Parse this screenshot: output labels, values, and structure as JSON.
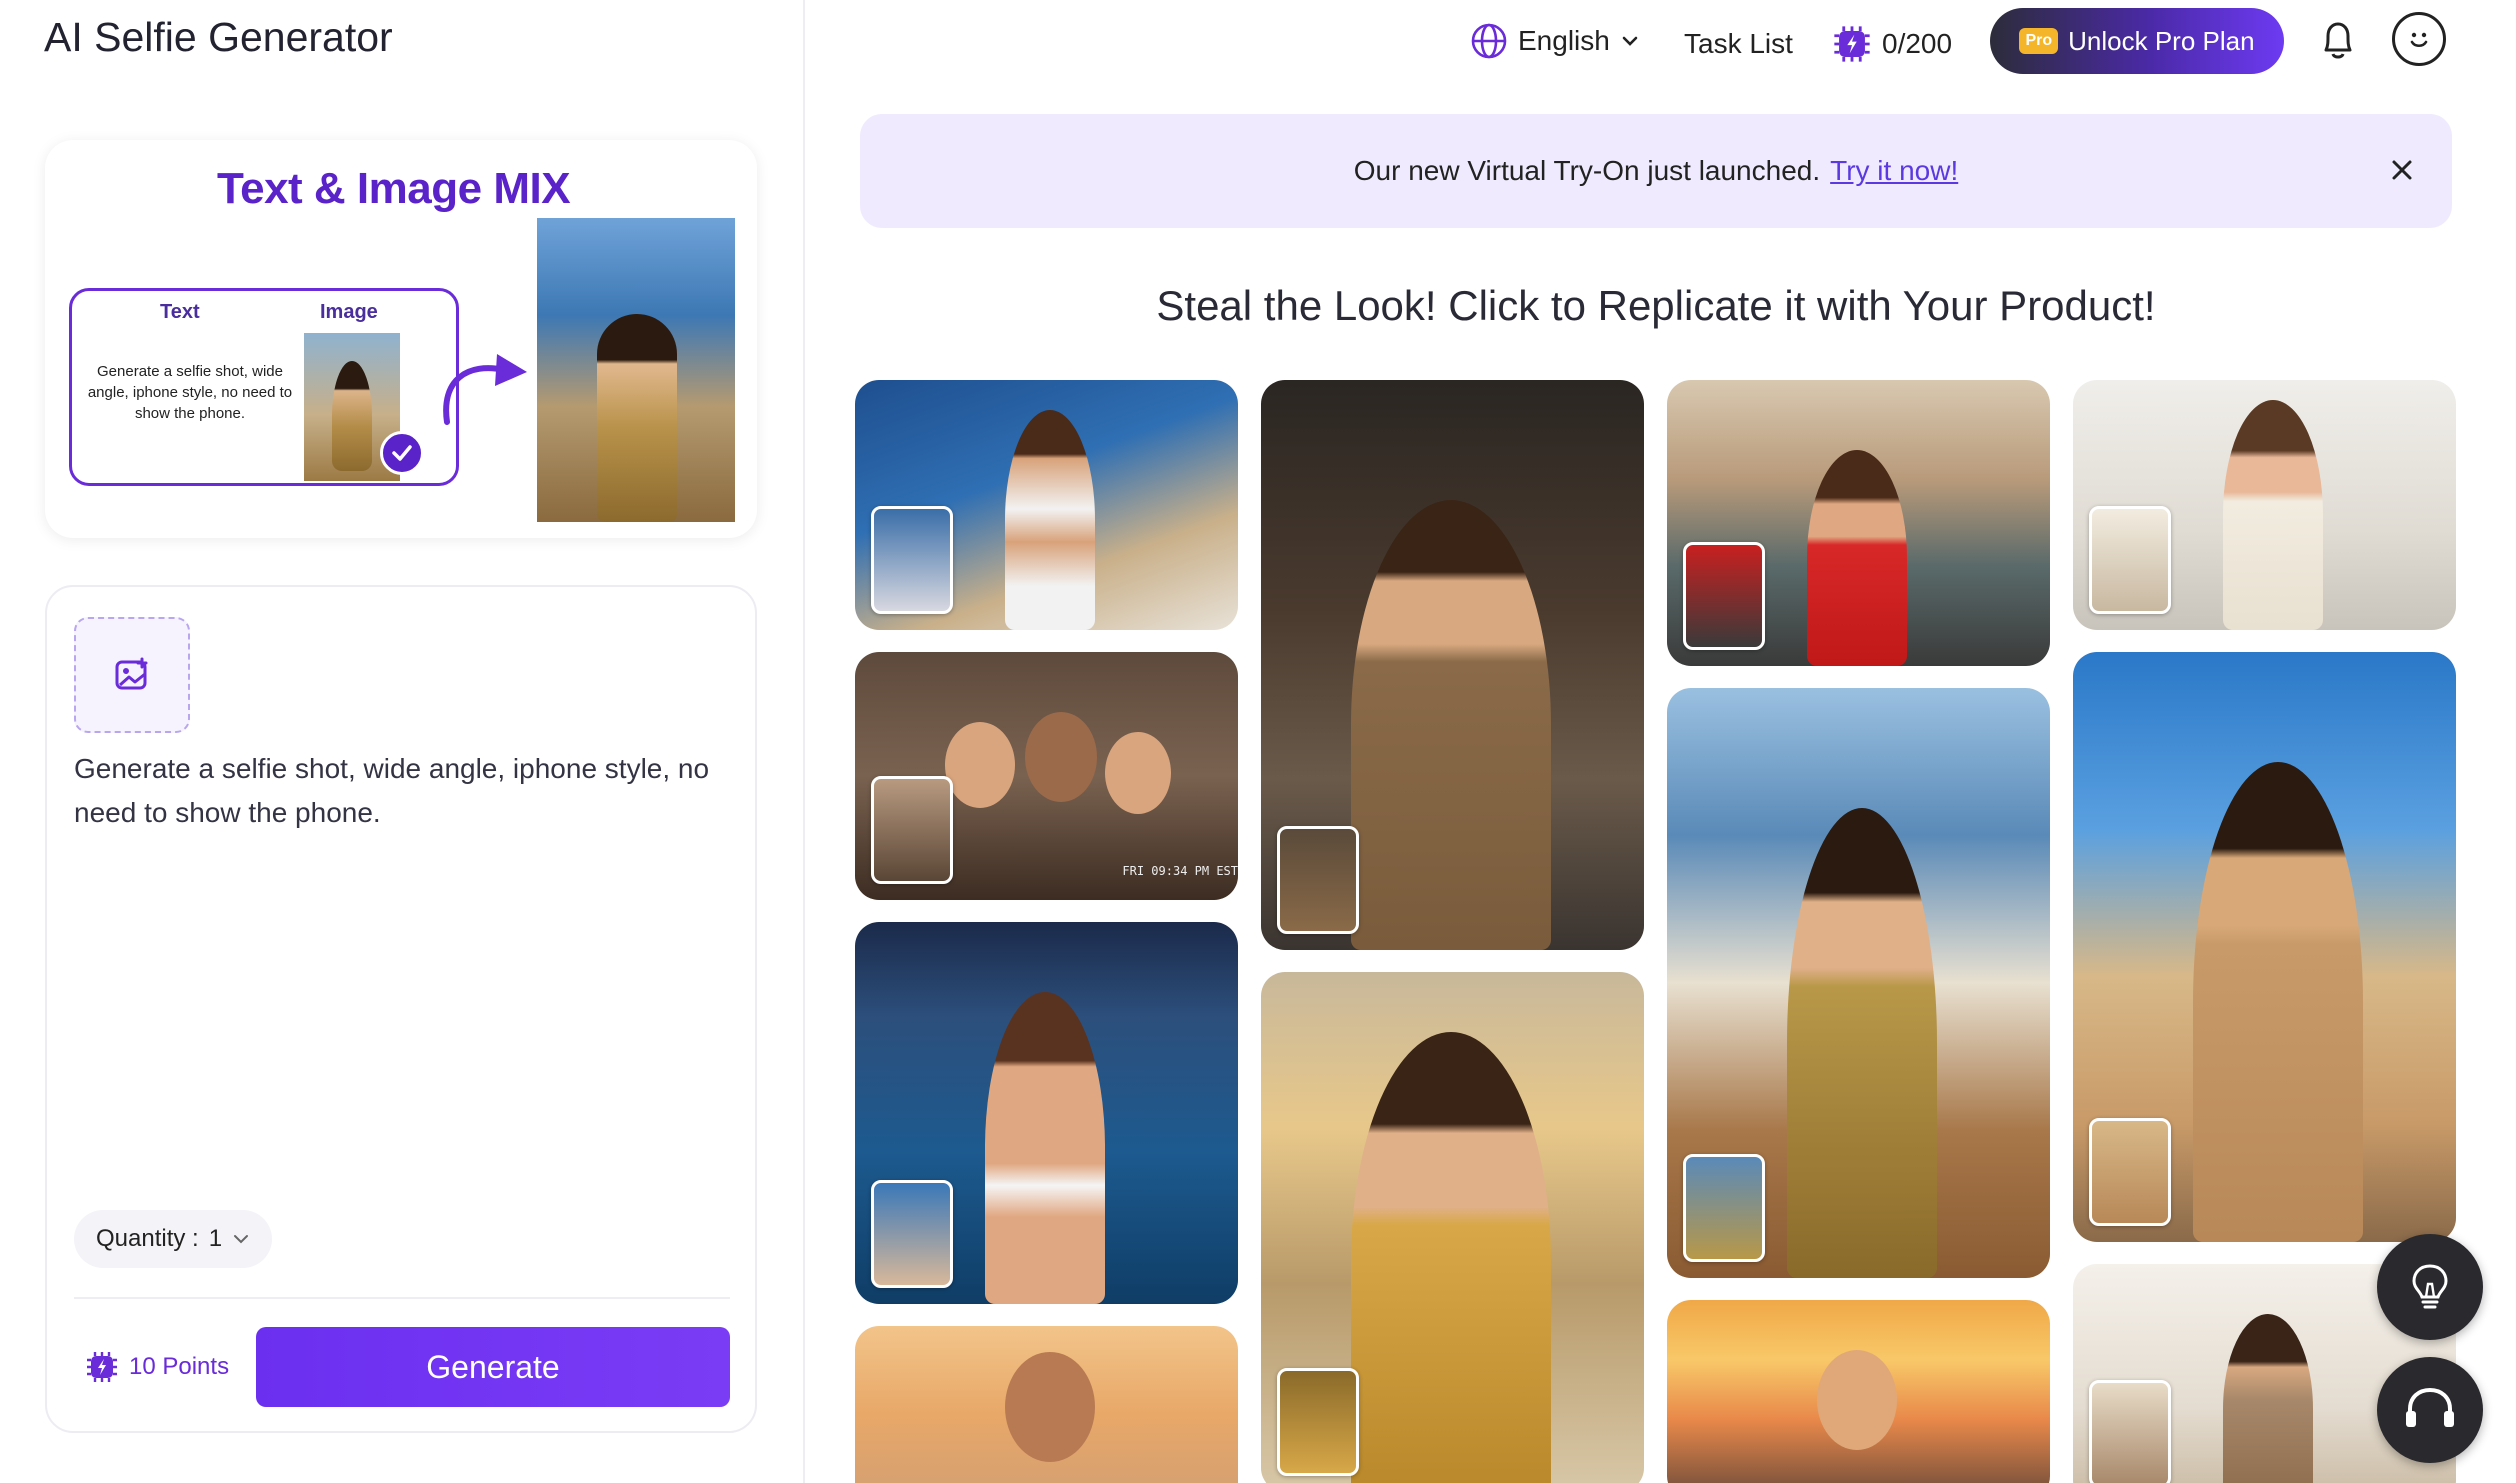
{
  "app": {
    "title": "AI Selfie Generator"
  },
  "mix_card": {
    "title": "Text & Image MIX",
    "text_header": "Text",
    "image_header": "Image",
    "description": "Generate a selfie shot, wide angle, iphone style, no need to show the phone."
  },
  "prompt": {
    "text": "Generate a selfie shot, wide angle, iphone style, no need to show the phone.",
    "quantity_label": "Quantity :",
    "quantity_value": "1",
    "points_label": "10 Points",
    "generate_label": "Generate"
  },
  "header": {
    "language": "English",
    "task_list": "Task List",
    "credits": "0/200",
    "pro_tag": "Pro",
    "unlock_label": "Unlock Pro Plan"
  },
  "banner": {
    "text": "Our new Virtual Try-On just launched.",
    "link": "Try it now!"
  },
  "gallery": {
    "title": "Steal the Look! Click to Replicate it with Your Product!",
    "timestamp": "FRI 09:34 PM EST"
  },
  "colors": {
    "accent": "#6b2ff0",
    "banner_bg": "#efeafd",
    "link": "#5a3ae0"
  }
}
